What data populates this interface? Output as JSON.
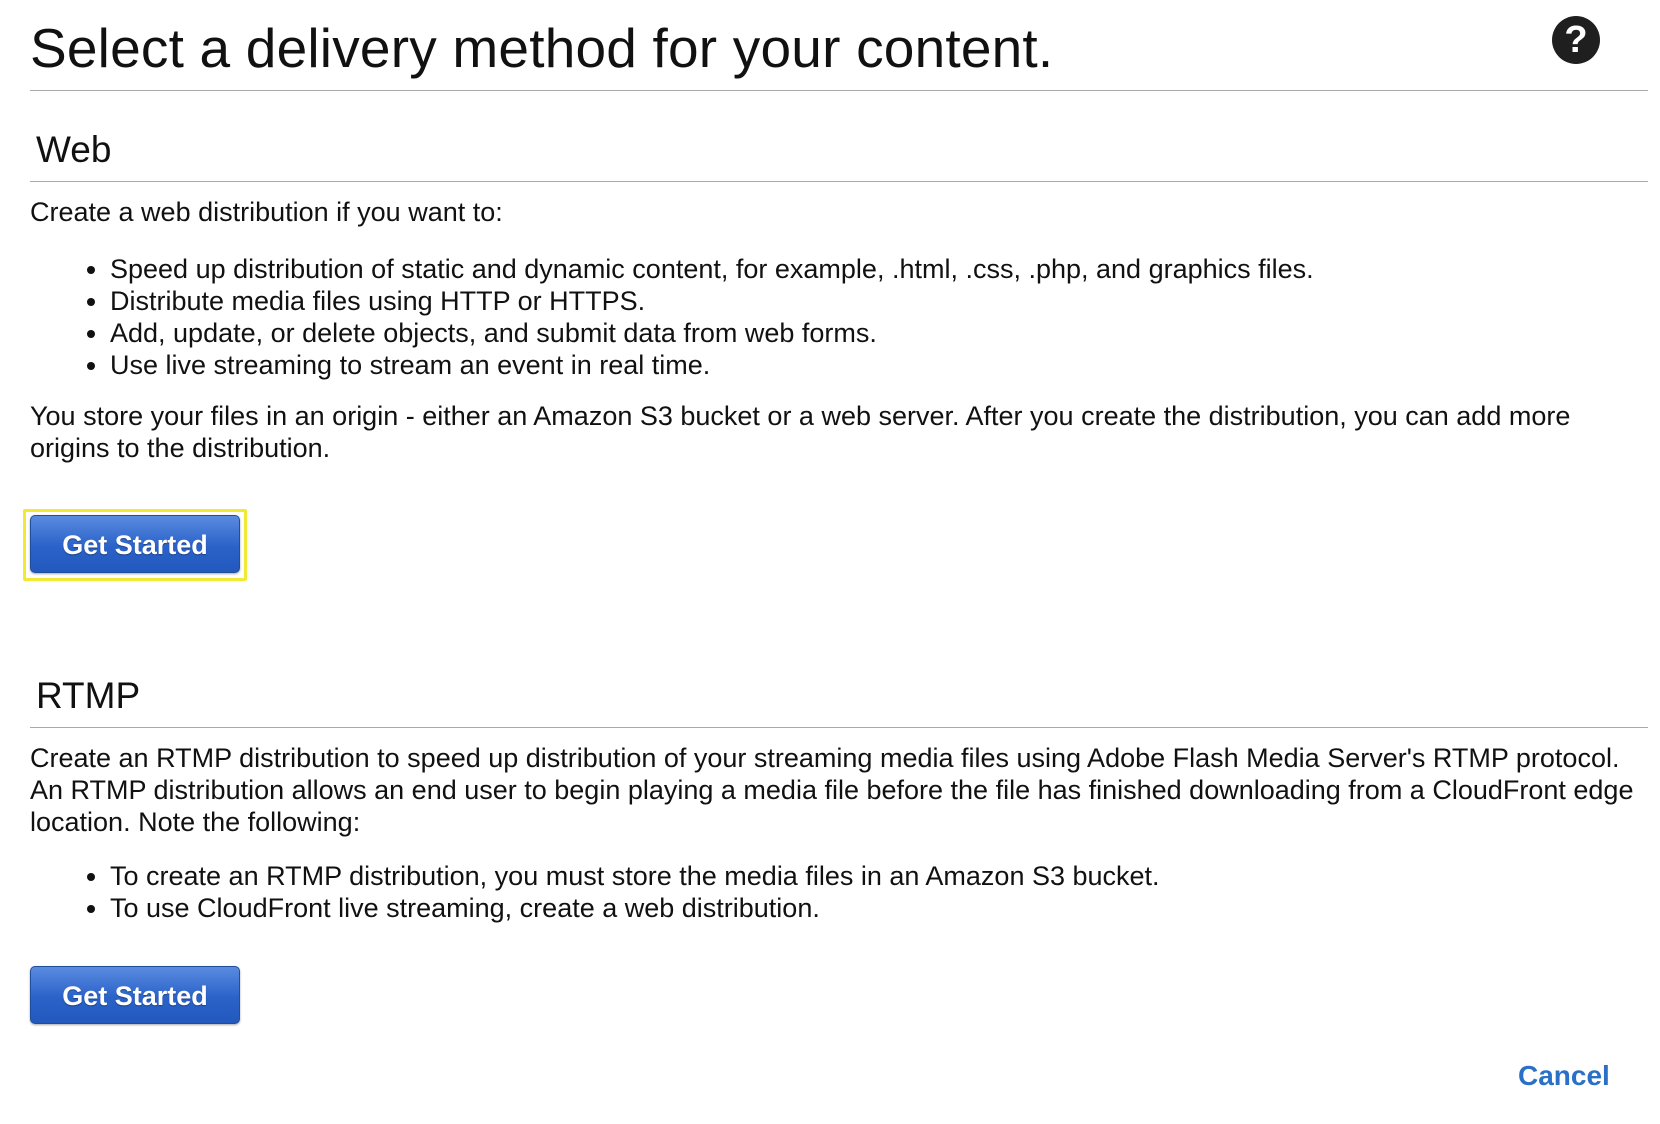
{
  "header": {
    "title": "Select a delivery method for your content.",
    "help_icon": "question-circle-icon"
  },
  "web": {
    "heading": "Web",
    "intro": "Create a web distribution if you want to:",
    "bullets": [
      "Speed up distribution of static and dynamic content, for example, .html, .css, .php, and graphics files.",
      "Distribute media files using HTTP or HTTPS.",
      "Add, update, or delete objects, and submit data from web forms.",
      "Use live streaming to stream an event in real time."
    ],
    "origin_text": "You store your files in an origin - either an Amazon S3 bucket or a web server. After you create the distribution, you can add more origins to the distribution.",
    "button_label": "Get Started"
  },
  "rtmp": {
    "heading": "RTMP",
    "intro": "Create an RTMP distribution to speed up distribution of your streaming media files using Adobe Flash Media Server's RTMP protocol. An RTMP distribution allows an end user to begin playing a media file before the file has finished downloading from a CloudFront edge location. Note the following:",
    "bullets": [
      "To create an RTMP distribution, you must store the media files in an Amazon S3 bucket.",
      "To use CloudFront live streaming, create a web distribution."
    ],
    "button_label": "Get Started"
  },
  "footer": {
    "cancel_label": "Cancel"
  },
  "colors": {
    "button_blue": "#2a62c9",
    "focus_yellow": "#f0ea34",
    "link_blue": "#2a70c7"
  }
}
